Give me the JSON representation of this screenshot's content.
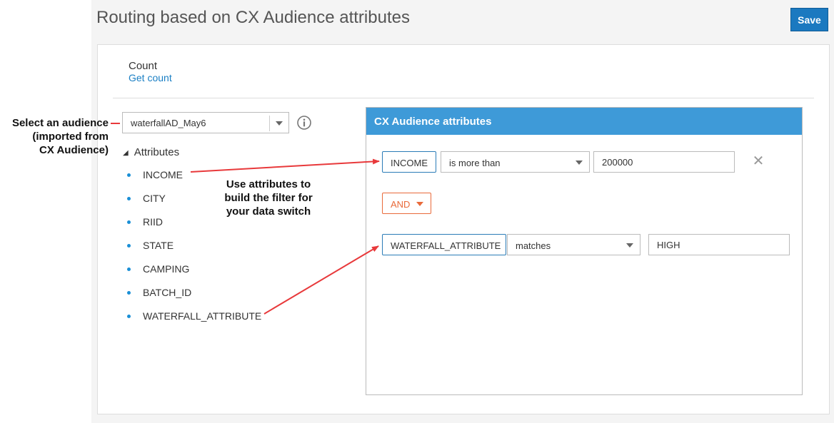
{
  "header": {
    "title": "Routing based on CX Audience attributes",
    "save_label": "Save"
  },
  "count": {
    "label": "Count",
    "link": "Get count"
  },
  "audience": {
    "selected": "waterfallAD_May6"
  },
  "attributes": {
    "heading": "Attributes",
    "items": [
      "INCOME",
      "CITY",
      "RIID",
      "STATE",
      "CAMPING",
      "BATCH_ID",
      "WATERFALL_ATTRIBUTE"
    ]
  },
  "panel": {
    "title": "CX Audience attributes",
    "rule1": {
      "attribute": "INCOME",
      "operator": "is more than",
      "value": "200000"
    },
    "connector": "AND",
    "rule2": {
      "attribute": "WATERFALL_ATTRIBUTE",
      "operator": "matches",
      "value": "HIGH"
    }
  },
  "annotations": {
    "select_audience": [
      "Select an audience",
      "(imported from",
      "CX Audience)"
    ],
    "use_attributes": [
      "Use attributes to",
      "build the filter for",
      "your data switch"
    ]
  },
  "colors": {
    "accent_blue": "#1b79c0",
    "panel_header": "#3e9ad8",
    "and_orange": "#e96a3a",
    "annotation_red": "#e8393b"
  }
}
